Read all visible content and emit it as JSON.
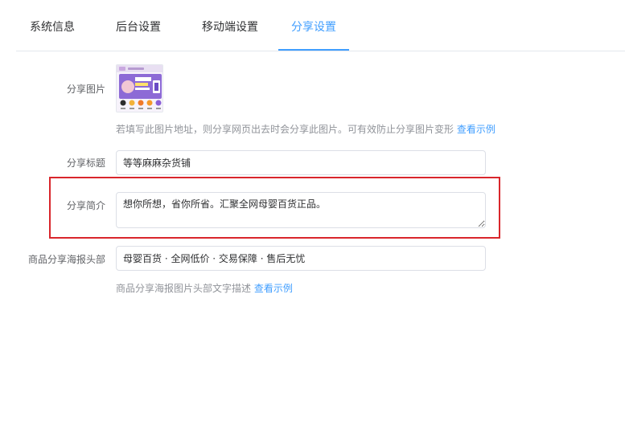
{
  "tabs": [
    {
      "label": "系统信息"
    },
    {
      "label": "后台设置"
    },
    {
      "label": "移动端设置"
    },
    {
      "label": "分享设置"
    }
  ],
  "active_tab": "分享设置",
  "form": {
    "share_image": {
      "label": "分享图片",
      "hint": "若填写此图片地址，则分享网页出去时会分享此图片。可有效防止分享图片变形",
      "example_link": "查看示例"
    },
    "share_title": {
      "label": "分享标题",
      "value": "等等麻麻杂货铺"
    },
    "share_intro": {
      "label": "分享简介",
      "value": "想你所想，省你所省。汇聚全网母婴百货正品。"
    },
    "poster_header": {
      "label": "商品分享海报头部",
      "value": "母婴百货 · 全网低价 · 交易保障 · 售后无忧",
      "hint": "商品分享海报图片头部文字描述",
      "example_link": "查看示例"
    }
  },
  "colors": {
    "accent": "#409eff",
    "highlight_border": "#d9262c"
  }
}
